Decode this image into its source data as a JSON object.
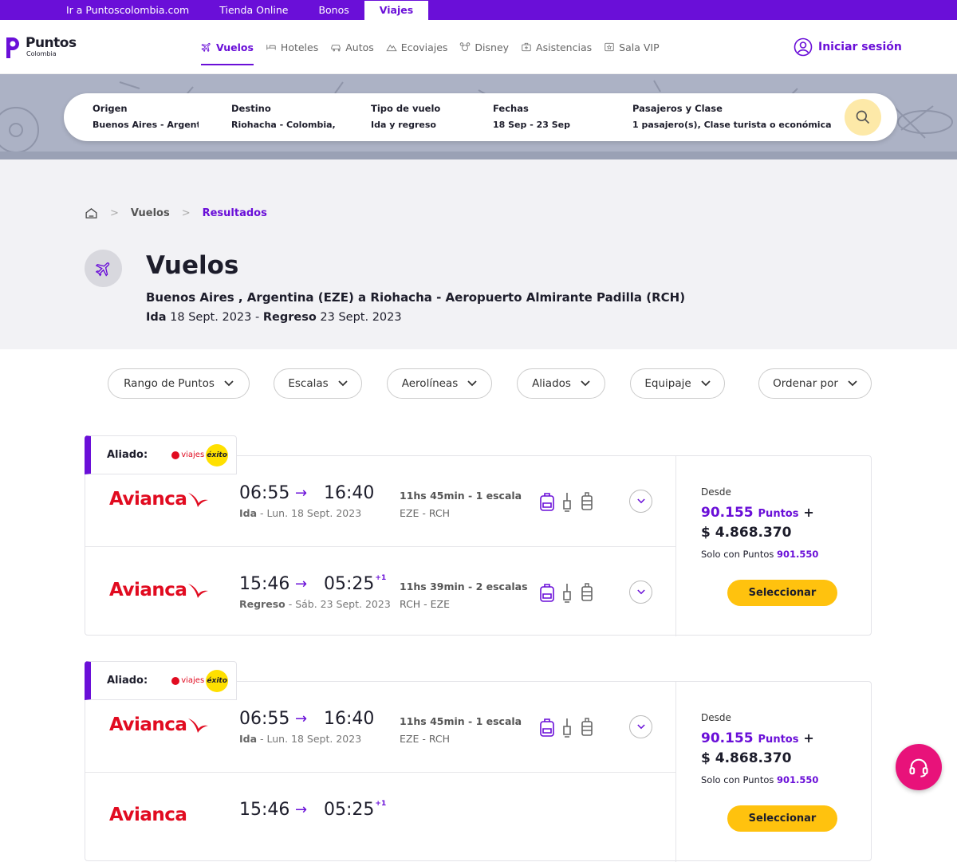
{
  "topbar": {
    "links": [
      "Ir a Puntoscolombia.com",
      "Tienda Online",
      "Bonos"
    ],
    "active": "Viajes"
  },
  "logo": {
    "name": "Puntos",
    "sub": "Colombia"
  },
  "nav": {
    "items": [
      "Vuelos",
      "Hoteles",
      "Autos",
      "Ecoviajes",
      "Disney",
      "Asistencias",
      "Sala VIP"
    ]
  },
  "login": {
    "label": "Iniciar sesión"
  },
  "search": {
    "origen_label": "Origen",
    "origen_value": "Buenos Aires - Argentina",
    "destino_label": "Destino",
    "destino_value": "Riohacha - Colombia, Aeropuerto",
    "tipo_label": "Tipo de vuelo",
    "tipo_value": "Ida y regreso",
    "fechas_label": "Fechas",
    "fechas_value": "18 Sep - 23 Sep",
    "pasajeros_label": "Pasajeros y Clase",
    "pasajeros_value": "1 pasajero(s), Clase turista o económica"
  },
  "breadcrumb": {
    "b1": "Vuelos",
    "b2": "Resultados"
  },
  "page": {
    "title": "Vuelos",
    "route": "Buenos Aires , Argentina (EZE) a Riohacha - Aeropuerto Almirante Padilla (RCH)",
    "ida_label": "Ida",
    "ida_date": "18 Sept. 2023",
    "regreso_label": "Regreso",
    "regreso_date": "23 Sept. 2023"
  },
  "filters": [
    "Rango de Puntos",
    "Escalas",
    "Aerolíneas",
    "Aliados",
    "Equipaje",
    "Ordenar por"
  ],
  "cards": [
    {
      "aliado_label": "Aliado:",
      "aliado_v": "viajes",
      "aliado_ex": "éxito",
      "seg1": {
        "airline": "Avianca",
        "dep": "06:55",
        "arr": "16:40",
        "dir": "Ida",
        "date": "- Lun. 18 Sept. 2023",
        "dur": "11hs 45min - 1 escala",
        "codes": "EZE - RCH"
      },
      "seg2": {
        "airline": "Avianca",
        "dep": "15:46",
        "arr": "05:25",
        "plus": "+1",
        "dir": "Regreso",
        "date": "- Sáb. 23 Sept. 2023",
        "dur": "11hs 39min - 2 escalas",
        "codes": "RCH - EZE"
      },
      "desde": "Desde",
      "points": "90.155",
      "points_unit": "Puntos",
      "plus": "+",
      "cash": "$ 4.868.370",
      "solo": "Solo con Puntos",
      "solo_pts": "901.550",
      "select": "Seleccionar"
    },
    {
      "aliado_label": "Aliado:",
      "aliado_v": "viajes",
      "aliado_ex": "éxito",
      "seg1": {
        "airline": "Avianca",
        "dep": "06:55",
        "arr": "16:40",
        "dir": "Ida",
        "date": "- Lun. 18 Sept. 2023",
        "dur": "11hs 45min - 1 escala",
        "codes": "EZE - RCH"
      },
      "seg2": {
        "airline": "Avianca",
        "dep": "15:46",
        "arr": "05:25",
        "plus": "+1",
        "dir": "",
        "date": "",
        "dur": "",
        "codes": ""
      },
      "desde": "Desde",
      "points": "90.155",
      "points_unit": "Puntos",
      "plus": "+",
      "cash": "$ 4.868.370",
      "solo": "Solo con Puntos",
      "solo_pts": "901.550",
      "select": "Seleccionar"
    }
  ],
  "colors": {
    "brand": "#6a0fd8",
    "accent": "#ffc20e",
    "airline": "#e10b20",
    "help": "#e8127a"
  }
}
